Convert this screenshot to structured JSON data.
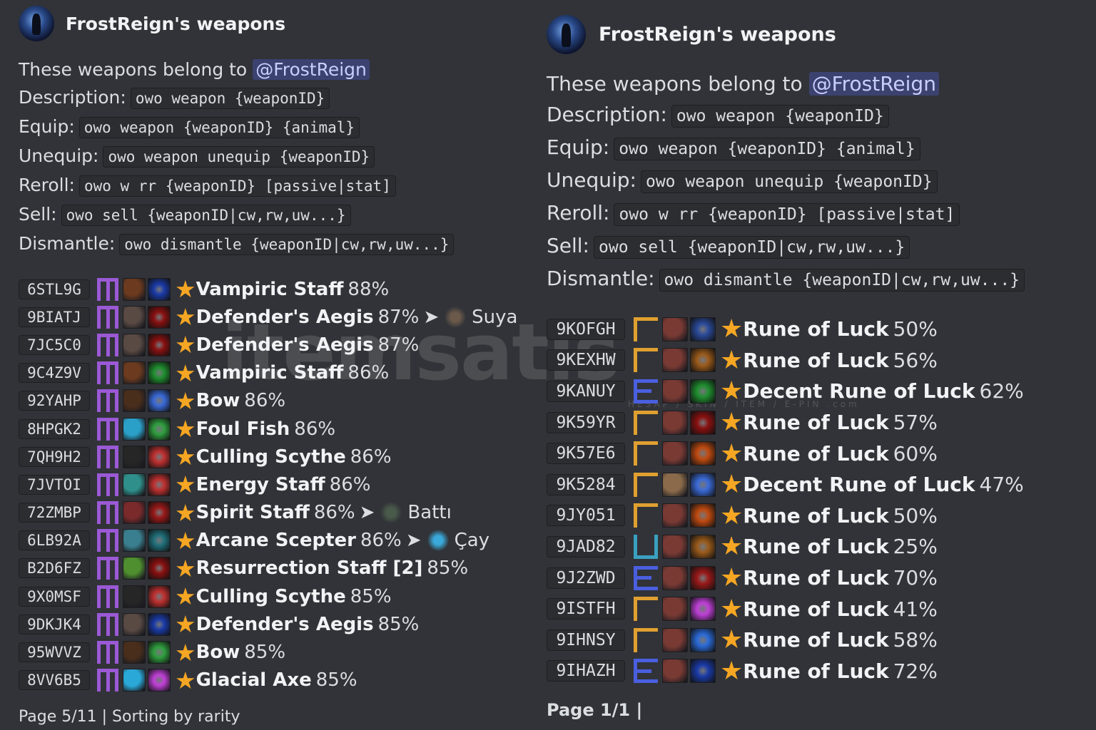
{
  "icon_colors": {
    "staff_brown": "#6b3a1f",
    "aegis_gray": "#5a4a44",
    "bow_dark": "#4a2e1c",
    "fish_cyan": "#2aa0c8",
    "scythe_black": "#262626",
    "energy_teal": "#2f8f8a",
    "spirit_red": "#7a2a2a",
    "scepter_teal": "#3a7f8f",
    "res_green": "#4f8f2f",
    "axe_cyan": "#2aa8d8",
    "rune_red": "#7a3a34",
    "rune_tan": "#8a6a4a",
    "p_blue": "#1a3aa8",
    "p_red": "#8a1010",
    "p_green": "#1f8f2f",
    "p_blue2": "#3a6ad8",
    "p_lime": "#2f9f3f",
    "p_red2": "#c03030",
    "p_crimson": "#9a1818",
    "p_purple": "#7a2ab8",
    "p_meditate": "#2a4a9a",
    "p_bronze": "#9a5a1a",
    "p_orange": "#c04a10",
    "p_pink": "#c040d8",
    "p_shield": "#2a6ad8"
  },
  "left": {
    "author": "FrostReign's weapons",
    "intro": "These weapons belong to",
    "mention": "@FrostReign",
    "commands": [
      {
        "label": "Description:",
        "code": "owo weapon {weaponID}"
      },
      {
        "label": "Equip:",
        "code": "owo weapon {weaponID} {animal}"
      },
      {
        "label": "Unequip:",
        "code": "owo weapon unequip {weaponID}"
      },
      {
        "label": "Reroll:",
        "code": "owo w rr {weaponID} [passive|stat]"
      },
      {
        "label": "Sell:",
        "code": "owo sell {weaponID|cw,rw,uw...}"
      },
      {
        "label": "Dismantle:",
        "code": "owo dismantle {weaponID|cw,rw,uw...}"
      }
    ],
    "weapons": [
      {
        "id": "6STL9G",
        "rarity": "m",
        "wicon": "staff-icon",
        "wcolor": "#6b3a1f",
        "picon": "blue-passive-icon",
        "pcolor": "#1a3aa8",
        "name": "Vampiric Staff",
        "pct": "88%",
        "arrow": "",
        "animal": "",
        "acolor": ""
      },
      {
        "id": "9BIATJ",
        "rarity": "m",
        "wicon": "aegis-icon",
        "wcolor": "#5a4a44",
        "picon": "red-passive-icon",
        "pcolor": "#8a1010",
        "name": "Defender's Aegis",
        "pct": "87%",
        "arrow": "➤",
        "animal": "Suya",
        "acolor": "#6b5a4a"
      },
      {
        "id": "7JC5C0",
        "rarity": "m",
        "wicon": "aegis-icon",
        "wcolor": "#5a4a44",
        "picon": "red-passive-icon",
        "pcolor": "#8a1010",
        "name": "Defender's Aegis",
        "pct": "87%",
        "arrow": "",
        "animal": "",
        "acolor": ""
      },
      {
        "id": "9C4Z9V",
        "rarity": "m",
        "wicon": "staff-icon",
        "wcolor": "#6b3a1f",
        "picon": "green-passive-icon",
        "pcolor": "#1f8f2f",
        "name": "Vampiric Staff",
        "pct": "86%",
        "arrow": "",
        "animal": "",
        "acolor": ""
      },
      {
        "id": "92YAHP",
        "rarity": "m",
        "wicon": "bow-icon",
        "wcolor": "#4a2e1c",
        "picon": "blue-slash-passive-icon",
        "pcolor": "#3a6ad8",
        "name": "Bow",
        "pct": "86%",
        "arrow": "",
        "animal": "",
        "acolor": ""
      },
      {
        "id": "8HPGK2",
        "rarity": "m",
        "wicon": "fish-icon",
        "wcolor": "#2aa0c8",
        "picon": "snail-passive-icon",
        "pcolor": "#2f9f3f",
        "name": "Foul Fish",
        "pct": "86%",
        "arrow": "",
        "animal": "",
        "acolor": ""
      },
      {
        "id": "7QH9H2",
        "rarity": "m",
        "wicon": "scythe-icon",
        "wcolor": "#262626",
        "picon": "fang-passive-icon",
        "pcolor": "#c03030",
        "name": "Culling Scythe",
        "pct": "86%",
        "arrow": "",
        "animal": "",
        "acolor": ""
      },
      {
        "id": "7JVTOI",
        "rarity": "m",
        "wicon": "energy-staff-icon",
        "wcolor": "#2f8f8a",
        "picon": "hand-passive-icon",
        "pcolor": "#c03030",
        "name": "Energy Staff",
        "pct": "86%",
        "arrow": "",
        "animal": "",
        "acolor": ""
      },
      {
        "id": "72ZMBP",
        "rarity": "m",
        "wicon": "spirit-staff-icon",
        "wcolor": "#7a2a2a",
        "picon": "red-passive-icon",
        "pcolor": "#9a1818",
        "name": "Spirit Staff",
        "pct": "86%",
        "arrow": "➤",
        "animal": "Battı",
        "acolor": "#4a5a4a"
      },
      {
        "id": "6LB92A",
        "rarity": "m",
        "wicon": "scepter-icon",
        "wcolor": "#3a7f8f",
        "picon": "teal-passive-icon",
        "pcolor": "#1f6f7a",
        "name": "Arcane Scepter",
        "pct": "86%",
        "arrow": "➤",
        "animal": "Çay",
        "acolor": "#3aa8d8"
      },
      {
        "id": "B2D6FZ",
        "rarity": "m",
        "wicon": "resurrection-staff-icon",
        "wcolor": "#4f8f2f",
        "picon": "red-passive-icon",
        "pcolor": "#8a1010",
        "name": "Resurrection Staff [2]",
        "pct": "85%",
        "arrow": "",
        "animal": "",
        "acolor": ""
      },
      {
        "id": "9X0MSF",
        "rarity": "m",
        "wicon": "scythe-icon",
        "wcolor": "#262626",
        "picon": "hand-passive-icon",
        "pcolor": "#c03030",
        "name": "Culling Scythe",
        "pct": "85%",
        "arrow": "",
        "animal": "",
        "acolor": ""
      },
      {
        "id": "9DKJK4",
        "rarity": "m",
        "wicon": "aegis-icon",
        "wcolor": "#5a4a44",
        "picon": "blue-passive-icon",
        "pcolor": "#1a3aa8",
        "name": "Defender's Aegis",
        "pct": "85%",
        "arrow": "",
        "animal": "",
        "acolor": ""
      },
      {
        "id": "95WVVZ",
        "rarity": "m",
        "wicon": "bow-icon",
        "wcolor": "#4a2e1c",
        "picon": "snail-passive-icon",
        "pcolor": "#2f9f3f",
        "name": "Bow",
        "pct": "85%",
        "arrow": "",
        "animal": "",
        "acolor": ""
      },
      {
        "id": "8VV6B5",
        "rarity": "m",
        "wicon": "axe-icon",
        "wcolor": "#2aa8d8",
        "picon": "pink-hand-passive-icon",
        "pcolor": "#c040d8",
        "name": "Glacial Axe",
        "pct": "85%",
        "arrow": "",
        "animal": "",
        "acolor": ""
      }
    ],
    "footer": "Page 5/11 | Sorting by rarity"
  },
  "right": {
    "author": "FrostReign's weapons",
    "intro": "These weapons belong to",
    "mention": "@FrostReign",
    "commands": [
      {
        "label": "Description:",
        "code": "owo weapon {weaponID}"
      },
      {
        "label": "Equip:",
        "code": "owo weapon {weaponID} {animal}"
      },
      {
        "label": "Unequip:",
        "code": "owo weapon unequip {weaponID}"
      },
      {
        "label": "Reroll:",
        "code": "owo w rr {weaponID} [passive|stat]"
      },
      {
        "label": "Sell:",
        "code": "owo sell {weaponID|cw,rw,uw...}"
      },
      {
        "label": "Dismantle:",
        "code": "owo dismantle {weaponID|cw,rw,uw...}"
      }
    ],
    "weapons": [
      {
        "id": "9KOFGH",
        "rarity": "c",
        "wicon": "rune-icon",
        "wcolor": "#7a3a34",
        "picon": "meditate-passive-icon",
        "pcolor": "#2a4a9a",
        "name": "Rune of Luck",
        "pct": "50%"
      },
      {
        "id": "9KEXHW",
        "rarity": "c",
        "wicon": "rune-icon",
        "wcolor": "#7a3a34",
        "picon": "bronze-passive-icon",
        "pcolor": "#9a5a1a",
        "name": "Rune of Luck",
        "pct": "56%"
      },
      {
        "id": "9KANUY",
        "rarity": "e",
        "wicon": "rune-icon",
        "wcolor": "#7a3a34",
        "picon": "green-passive-icon",
        "pcolor": "#1f8f2f",
        "name": "Decent Rune of Luck",
        "pct": "62%"
      },
      {
        "id": "9K59YR",
        "rarity": "c",
        "wicon": "rune-icon",
        "wcolor": "#7a3a34",
        "picon": "red-passive-icon",
        "pcolor": "#8a1010",
        "name": "Rune of Luck",
        "pct": "57%"
      },
      {
        "id": "9K57E6",
        "rarity": "c",
        "wicon": "rune-icon",
        "wcolor": "#7a3a34",
        "picon": "orange-passive-icon",
        "pcolor": "#c04a10",
        "name": "Rune of Luck",
        "pct": "60%"
      },
      {
        "id": "9K5284",
        "rarity": "c",
        "wicon": "rune-icon",
        "wcolor": "#8a6a4a",
        "picon": "blue-slash-passive-icon",
        "pcolor": "#3a6ad8",
        "name": "Decent Rune of Luck",
        "pct": "47%"
      },
      {
        "id": "9JY051",
        "rarity": "c",
        "wicon": "rune-icon",
        "wcolor": "#7a3a34",
        "picon": "orange-passive-icon",
        "pcolor": "#c04a10",
        "name": "Rune of Luck",
        "pct": "50%"
      },
      {
        "id": "9JAD82",
        "rarity": "u",
        "wicon": "rune-icon",
        "wcolor": "#7a3a34",
        "picon": "bronze-passive-icon",
        "pcolor": "#9a5a1a",
        "name": "Rune of Luck",
        "pct": "25%"
      },
      {
        "id": "9J2ZWD",
        "rarity": "e",
        "wicon": "rune-icon",
        "wcolor": "#7a3a34",
        "picon": "red-passive-icon",
        "pcolor": "#9a1818",
        "name": "Rune of Luck",
        "pct": "70%"
      },
      {
        "id": "9ISTFH",
        "rarity": "c",
        "wicon": "rune-icon",
        "wcolor": "#7a3a34",
        "picon": "pink-passive-icon",
        "pcolor": "#c040d8",
        "name": "Rune of Luck",
        "pct": "41%"
      },
      {
        "id": "9IHNSY",
        "rarity": "c",
        "wicon": "rune-icon",
        "wcolor": "#7a3a34",
        "picon": "shield-passive-icon",
        "pcolor": "#2a6ad8",
        "name": "Rune of Luck",
        "pct": "58%"
      },
      {
        "id": "9IHAZH",
        "rarity": "e",
        "wicon": "rune-icon",
        "wcolor": "#7a3a34",
        "picon": "blue-passive-icon",
        "pcolor": "#1a3aa8",
        "name": "Rune of Luck",
        "pct": "72%"
      }
    ],
    "footer": "Page 1/1 |"
  },
  "watermark": {
    "main": "itemsatis",
    "sub": "HESAP / SKIN / ITEM / E-PIN  .com"
  }
}
